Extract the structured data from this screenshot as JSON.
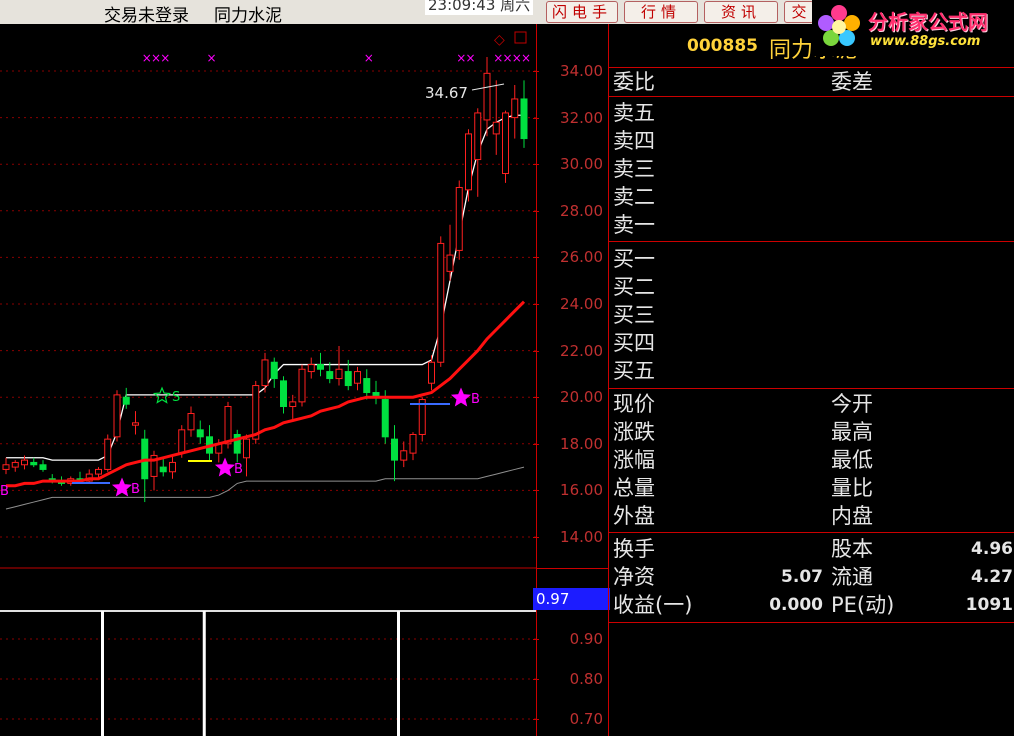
{
  "topbar": {
    "login_status": "交易未登录",
    "stock_title": "同力水泥",
    "clock": "23:09:43 周六",
    "buttons": [
      "闪电手",
      "行情",
      "资讯",
      "交"
    ]
  },
  "logo": {
    "name": "分析家公式网",
    "url": "www.88gs.com"
  },
  "chart": {
    "price_annotation": "34.67",
    "signal_label": "B",
    "buy_labels": [
      "B",
      "B",
      "B",
      "B",
      "B"
    ],
    "star_label": "S",
    "y_axis_ticks": [
      "34.00",
      "32.00",
      "30.00",
      "28.00",
      "26.00",
      "24.00",
      "22.00",
      "20.00",
      "18.00",
      "16.00",
      "14.00"
    ],
    "indicator_value": "0.97",
    "indicator_ticks": [
      "0.90",
      "0.80",
      "0.70"
    ],
    "colors": {
      "up": "#ff2020",
      "down": "#00e040",
      "ma_red": "#ff1010",
      "band_white": "#ffffff",
      "band_gray": "#909090",
      "marker": "#ff00ff"
    }
  },
  "chart_data": {
    "type": "candlestick",
    "ylim": [
      13.5,
      34.8
    ],
    "candles": [
      {
        "o": 16.9,
        "h": 17.4,
        "l": 16.7,
        "c": 17.1
      },
      {
        "o": 17.0,
        "h": 17.3,
        "l": 16.8,
        "c": 17.2
      },
      {
        "o": 17.1,
        "h": 17.5,
        "l": 16.9,
        "c": 17.3
      },
      {
        "o": 17.2,
        "h": 17.4,
        "l": 17.0,
        "c": 17.1
      },
      {
        "o": 17.1,
        "h": 17.3,
        "l": 16.8,
        "c": 16.9
      },
      {
        "o": 16.5,
        "h": 16.7,
        "l": 16.3,
        "c": 16.4
      },
      {
        "o": 16.4,
        "h": 16.6,
        "l": 16.2,
        "c": 16.3
      },
      {
        "o": 16.3,
        "h": 16.6,
        "l": 16.2,
        "c": 16.5
      },
      {
        "o": 16.5,
        "h": 16.8,
        "l": 16.3,
        "c": 16.4
      },
      {
        "o": 16.4,
        "h": 16.9,
        "l": 16.3,
        "c": 16.7
      },
      {
        "o": 16.7,
        "h": 17.0,
        "l": 16.5,
        "c": 16.9
      },
      {
        "o": 16.9,
        "h": 18.4,
        "l": 16.8,
        "c": 18.2
      },
      {
        "o": 18.3,
        "h": 20.3,
        "l": 18.1,
        "c": 20.1
      },
      {
        "o": 20.0,
        "h": 20.4,
        "l": 19.5,
        "c": 19.7
      },
      {
        "o": 18.8,
        "h": 19.4,
        "l": 18.4,
        "c": 18.9
      },
      {
        "o": 18.2,
        "h": 18.6,
        "l": 15.5,
        "c": 16.5
      },
      {
        "o": 16.6,
        "h": 17.7,
        "l": 16.0,
        "c": 17.5
      },
      {
        "o": 17.0,
        "h": 17.4,
        "l": 16.6,
        "c": 16.8
      },
      {
        "o": 16.8,
        "h": 17.5,
        "l": 16.5,
        "c": 17.2
      },
      {
        "o": 17.6,
        "h": 18.8,
        "l": 17.4,
        "c": 18.6
      },
      {
        "o": 18.6,
        "h": 19.6,
        "l": 18.3,
        "c": 19.3
      },
      {
        "o": 18.6,
        "h": 19.0,
        "l": 18.0,
        "c": 18.3
      },
      {
        "o": 18.3,
        "h": 18.8,
        "l": 17.3,
        "c": 17.6
      },
      {
        "o": 17.6,
        "h": 18.2,
        "l": 17.2,
        "c": 18.0
      },
      {
        "o": 18.0,
        "h": 19.8,
        "l": 17.8,
        "c": 19.6
      },
      {
        "o": 18.4,
        "h": 18.6,
        "l": 17.2,
        "c": 17.6
      },
      {
        "o": 17.4,
        "h": 18.4,
        "l": 16.6,
        "c": 18.2
      },
      {
        "o": 18.2,
        "h": 20.7,
        "l": 18.0,
        "c": 20.5
      },
      {
        "o": 20.5,
        "h": 21.9,
        "l": 20.2,
        "c": 21.6
      },
      {
        "o": 21.5,
        "h": 21.7,
        "l": 20.4,
        "c": 20.8
      },
      {
        "o": 20.7,
        "h": 20.9,
        "l": 19.3,
        "c": 19.6
      },
      {
        "o": 19.6,
        "h": 20.1,
        "l": 19.0,
        "c": 19.8
      },
      {
        "o": 19.8,
        "h": 21.4,
        "l": 19.6,
        "c": 21.2
      },
      {
        "o": 21.1,
        "h": 21.7,
        "l": 20.8,
        "c": 21.4
      },
      {
        "o": 21.4,
        "h": 21.9,
        "l": 20.9,
        "c": 21.2
      },
      {
        "o": 21.1,
        "h": 21.5,
        "l": 20.6,
        "c": 20.8
      },
      {
        "o": 20.8,
        "h": 22.2,
        "l": 20.5,
        "c": 21.2
      },
      {
        "o": 21.1,
        "h": 21.6,
        "l": 20.3,
        "c": 20.5
      },
      {
        "o": 20.6,
        "h": 21.3,
        "l": 20.3,
        "c": 21.1
      },
      {
        "o": 20.8,
        "h": 21.2,
        "l": 19.9,
        "c": 20.2
      },
      {
        "o": 20.2,
        "h": 20.7,
        "l": 19.7,
        "c": 20.0
      },
      {
        "o": 19.9,
        "h": 20.3,
        "l": 18.0,
        "c": 18.3
      },
      {
        "o": 18.2,
        "h": 18.8,
        "l": 16.4,
        "c": 17.3
      },
      {
        "o": 17.3,
        "h": 18.1,
        "l": 17.0,
        "c": 17.7
      },
      {
        "o": 17.6,
        "h": 18.5,
        "l": 17.3,
        "c": 18.4
      },
      {
        "o": 18.4,
        "h": 20.0,
        "l": 18.1,
        "c": 19.9
      },
      {
        "o": 20.6,
        "h": 21.8,
        "l": 20.3,
        "c": 21.5
      },
      {
        "o": 21.5,
        "h": 26.9,
        "l": 21.3,
        "c": 26.6
      },
      {
        "o": 25.4,
        "h": 27.4,
        "l": 25.0,
        "c": 26.1
      },
      {
        "o": 26.3,
        "h": 29.3,
        "l": 25.9,
        "c": 29.0
      },
      {
        "o": 28.9,
        "h": 31.5,
        "l": 28.4,
        "c": 31.3
      },
      {
        "o": 30.2,
        "h": 32.4,
        "l": 28.6,
        "c": 32.2
      },
      {
        "o": 31.9,
        "h": 34.6,
        "l": 31.2,
        "c": 33.9
      },
      {
        "o": 31.3,
        "h": 33.6,
        "l": 30.4,
        "c": 31.8
      },
      {
        "o": 29.6,
        "h": 32.3,
        "l": 29.2,
        "c": 32.2
      },
      {
        "o": 32.0,
        "h": 33.4,
        "l": 31.1,
        "c": 32.8
      },
      {
        "o": 32.8,
        "h": 33.6,
        "l": 30.7,
        "c": 31.1
      }
    ],
    "ma_red": [
      16.2,
      16.2,
      16.3,
      16.3,
      16.4,
      16.4,
      16.4,
      16.4,
      16.4,
      16.5,
      16.5,
      16.7,
      16.9,
      17.1,
      17.2,
      17.3,
      17.3,
      17.4,
      17.5,
      17.6,
      17.7,
      17.8,
      17.9,
      18.0,
      18.1,
      18.2,
      18.3,
      18.4,
      18.6,
      18.7,
      18.9,
      19.0,
      19.1,
      19.2,
      19.4,
      19.5,
      19.6,
      19.8,
      19.9,
      20.0,
      20.0,
      20.0,
      20.0,
      20.0,
      20.0,
      20.1,
      20.2,
      20.5,
      20.8,
      21.2,
      21.6,
      22.0,
      22.5,
      22.9,
      23.3,
      23.7,
      24.1
    ],
    "band_white": [
      17.4,
      17.4,
      17.4,
      17.4,
      17.4,
      17.3,
      17.3,
      17.3,
      17.3,
      17.3,
      17.3,
      17.5,
      18.5,
      20.1,
      20.1,
      20.1,
      20.1,
      20.1,
      20.1,
      20.1,
      20.1,
      20.1,
      20.1,
      20.1,
      20.1,
      20.1,
      20.1,
      20.1,
      20.4,
      21.0,
      21.4,
      21.4,
      21.4,
      21.4,
      21.4,
      21.4,
      21.4,
      21.4,
      21.4,
      21.4,
      21.4,
      21.4,
      21.4,
      21.4,
      21.4,
      21.4,
      21.6,
      23.0,
      25.0,
      27.0,
      29.0,
      30.5,
      31.5,
      31.8,
      32.0,
      32.1,
      32.1
    ],
    "band_gray": [
      15.2,
      15.3,
      15.4,
      15.5,
      15.6,
      15.7,
      15.7,
      15.7,
      15.7,
      15.7,
      15.7,
      15.7,
      15.7,
      15.7,
      15.7,
      15.7,
      15.7,
      15.7,
      15.7,
      15.7,
      15.7,
      15.7,
      15.7,
      15.8,
      16.0,
      16.3,
      16.4,
      16.4,
      16.4,
      16.4,
      16.4,
      16.4,
      16.4,
      16.4,
      16.4,
      16.4,
      16.4,
      16.4,
      16.4,
      16.4,
      16.4,
      16.5,
      16.5,
      16.5,
      16.5,
      16.5,
      16.5,
      16.5,
      16.5,
      16.5,
      16.5,
      16.5,
      16.6,
      16.7,
      16.8,
      16.9,
      17.0
    ],
    "vertical_signal_bars_at": [
      10,
      21,
      42
    ]
  },
  "panel": {
    "code": "000885",
    "name": "同力水泥",
    "weibi": "委比",
    "weicha": "委差",
    "sell": [
      "卖五",
      "卖四",
      "卖三",
      "卖二",
      "卖一"
    ],
    "buy": [
      "买一",
      "买二",
      "买三",
      "买四",
      "买五"
    ],
    "left_labels": [
      "现价",
      "涨跌",
      "涨幅",
      "总量",
      "外盘"
    ],
    "right_labels": [
      "今开",
      "最高",
      "最低",
      "量比",
      "内盘"
    ],
    "turnover": "换手",
    "share_capital": "股本",
    "share_capital_value": "4.96",
    "net_assets": "净资",
    "net_assets_value": "5.07",
    "float": "流通",
    "float_value": "4.27",
    "eps": "收益(一)",
    "eps_value": "0.000",
    "pe": "PE(动)",
    "pe_value": "1091"
  }
}
